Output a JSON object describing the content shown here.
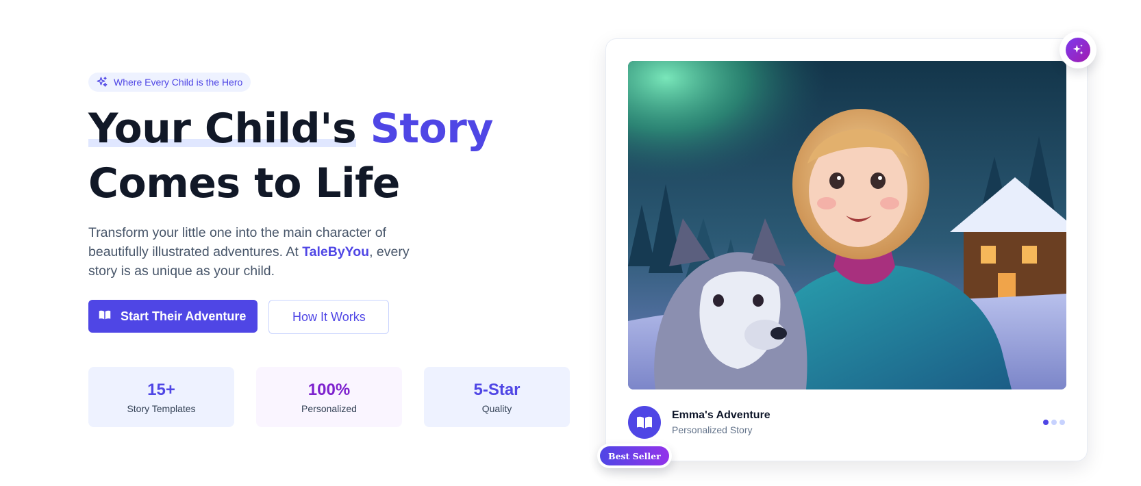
{
  "hero": {
    "tagline": "Where Every Child is the Hero",
    "headline_part1": "Your Child's",
    "headline_accent": "Story",
    "headline_line2": "Comes to Life",
    "description_before": "Transform your little one into the main character of beautifully illustrated adventures. At ",
    "description_brand": "TaleByYou",
    "description_after": ", every story is as unique as your child.",
    "primary_cta": "Start Their Adventure",
    "secondary_cta": "How It Works"
  },
  "stats": [
    {
      "value": "15+",
      "label": "Story Templates"
    },
    {
      "value": "100%",
      "label": "Personalized"
    },
    {
      "value": "5-Star",
      "label": "Quality"
    }
  ],
  "story_card": {
    "title": "Emma's Adventure",
    "subtitle": "Personalized Story",
    "badge": "Best Seller",
    "image_icon": "illustration-girl-with-husky-northern-lights",
    "carousel_dots": 3,
    "active_dot": 0
  },
  "colors": {
    "primary": "#4f46e5",
    "accent_purple": "#7e22ce",
    "heading": "#111827",
    "body": "#475569"
  },
  "icons": {
    "tagline": "sparkles-icon",
    "primary_cta": "open-book-icon",
    "card_badge": "open-book-icon",
    "fab": "sparkles-icon"
  }
}
